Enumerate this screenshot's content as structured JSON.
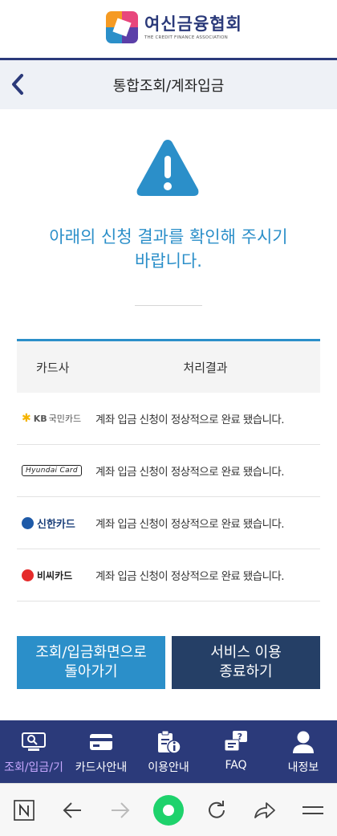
{
  "header": {
    "logo_title": "여신금융협회",
    "logo_sub": "THE CREDIT FINANCE ASSOCIATION"
  },
  "title_bar": {
    "title": "통합조회/계좌입금"
  },
  "notice": {
    "line1": "아래의 신청 결과를 확인해 주시기",
    "line2": "바랍니다."
  },
  "table": {
    "headers": [
      "카드사",
      "처리결과"
    ],
    "rows": [
      {
        "company": "KB국민카드",
        "logo_text_a": "KB",
        "logo_text_b": "국민카드",
        "result": "계좌 입금 신청이 정상적으로 완료 됐습니다."
      },
      {
        "company": "Hyundai Card",
        "logo_text_a": "Hyundai Card",
        "result": "계좌 입금 신청이 정상적으로 완료 됐습니다."
      },
      {
        "company": "신한카드",
        "logo_text_a": "신한카드",
        "result": "계좌 입금 신청이 정상적으로 완료 됐습니다."
      },
      {
        "company": "비씨카드",
        "logo_text_a": "비씨카드",
        "result": "계좌 입금 신청이 정상적으로 완료 됐습니다."
      }
    ]
  },
  "buttons": {
    "back_line1": "조회/입금화면으로",
    "back_line2": "돌아가기",
    "end_line1": "서비스 이용",
    "end_line2": "종료하기"
  },
  "bottom_nav": {
    "items": [
      {
        "label": "조회/입금/기",
        "icon": "monitor-search-icon"
      },
      {
        "label": "카드사안내",
        "icon": "card-icon"
      },
      {
        "label": "이용안내",
        "icon": "clipboard-info-icon"
      },
      {
        "label": "FAQ",
        "icon": "faq-icon"
      },
      {
        "label": "내정보",
        "icon": "person-icon"
      }
    ]
  },
  "colors": {
    "brand_navy": "#2b3a7a",
    "accent_blue": "#2b8fc9",
    "dark_button": "#253f66"
  }
}
